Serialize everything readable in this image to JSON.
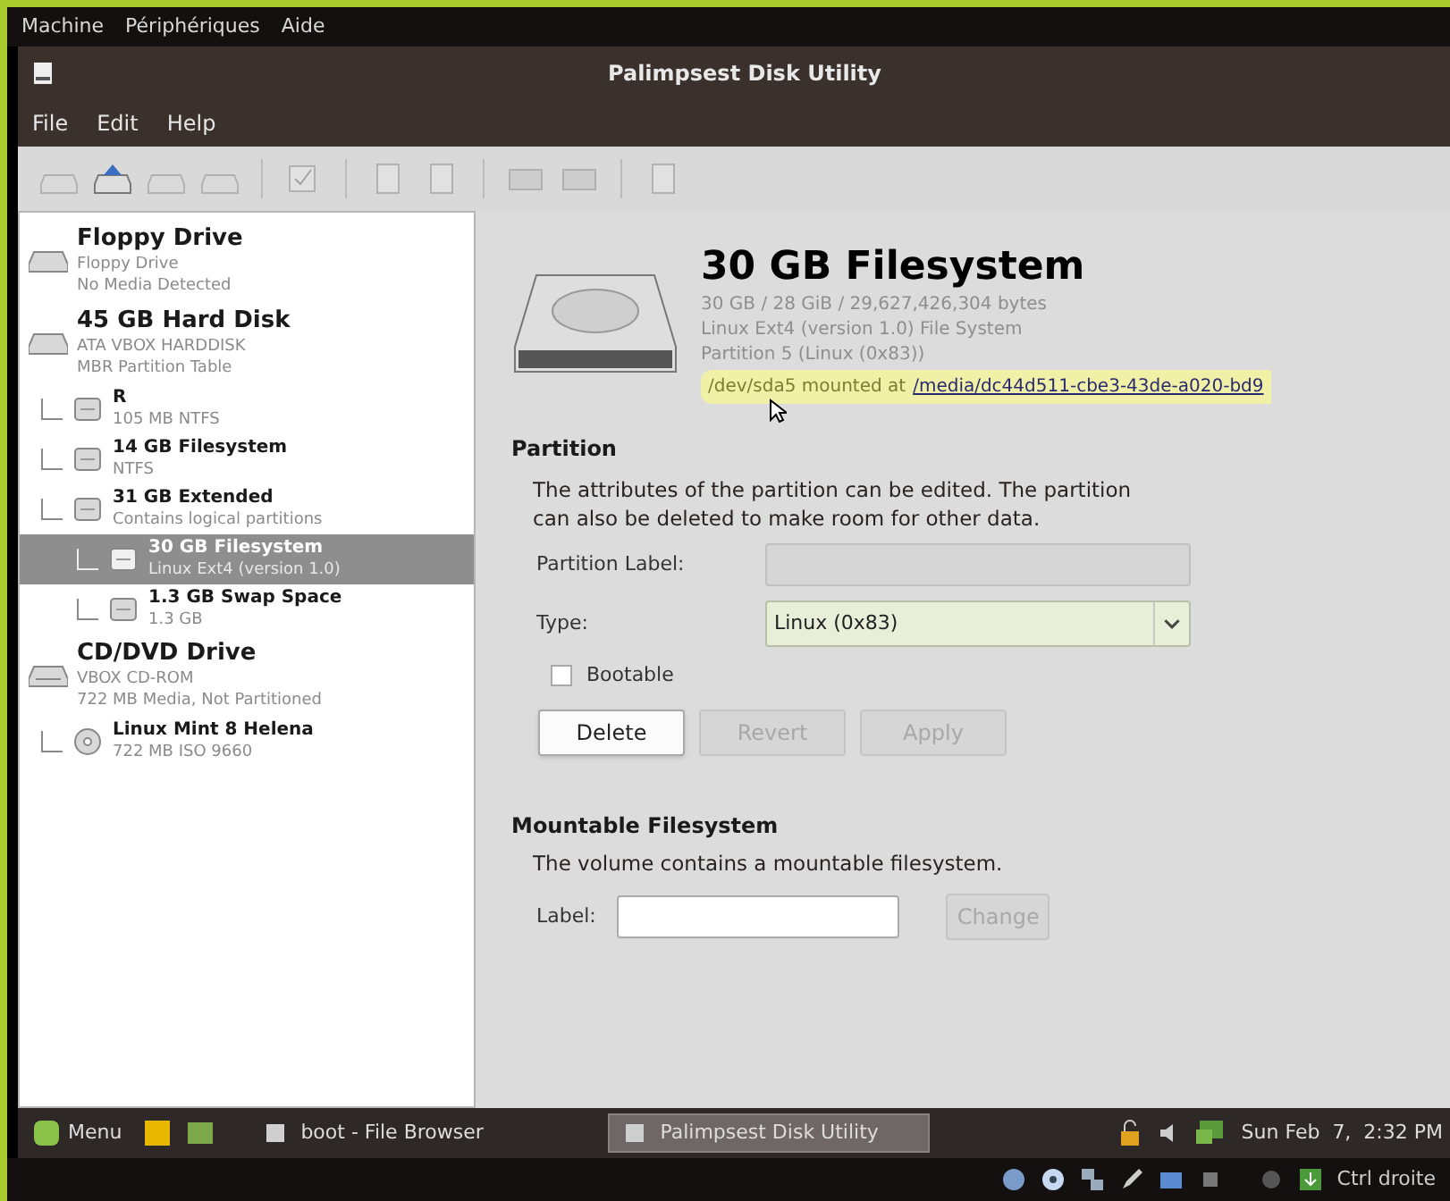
{
  "host_menu": [
    "Machine",
    "Périphériques",
    "Aide"
  ],
  "window": {
    "title": "Palimpsest Disk Utility"
  },
  "menu": [
    "File",
    "Edit",
    "Help"
  ],
  "toolbar": [
    {
      "kind": "drive",
      "disabled": true
    },
    {
      "kind": "drive-blue",
      "disabled": false
    },
    {
      "kind": "drive",
      "disabled": true
    },
    {
      "kind": "drive",
      "disabled": true
    },
    {
      "kind": "separator"
    },
    {
      "kind": "check",
      "disabled": true
    },
    {
      "kind": "separator"
    },
    {
      "kind": "doc",
      "disabled": true
    },
    {
      "kind": "doc",
      "disabled": true
    },
    {
      "kind": "separator"
    },
    {
      "kind": "screen",
      "disabled": true
    },
    {
      "kind": "screen",
      "disabled": true
    },
    {
      "kind": "separator"
    },
    {
      "kind": "doc",
      "disabled": true
    }
  ],
  "tree": [
    {
      "kind": "floppy",
      "title": "Floppy Drive",
      "lines": [
        "Floppy Drive",
        "No Media Detected"
      ],
      "selected": false
    },
    {
      "kind": "hdd",
      "title": "45 GB Hard Disk",
      "lines": [
        "ATA VBOX HARDDISK",
        "MBR Partition Table"
      ],
      "selected": false,
      "children": [
        {
          "kind": "partition",
          "title": "R",
          "lines": [
            "105 MB NTFS"
          ],
          "selected": false
        },
        {
          "kind": "partition",
          "title": "14 GB Filesystem",
          "lines": [
            "NTFS"
          ],
          "selected": false
        },
        {
          "kind": "partition",
          "title": "31 GB Extended",
          "lines": [
            "Contains logical partitions"
          ],
          "selected": false,
          "children": [
            {
              "kind": "partition",
              "title": "30 GB Filesystem",
              "lines": [
                "Linux Ext4 (version 1.0)"
              ],
              "selected": true
            },
            {
              "kind": "partition",
              "title": "1.3 GB Swap Space",
              "lines": [
                "1.3 GB"
              ],
              "selected": false
            }
          ]
        }
      ]
    },
    {
      "kind": "cdrom",
      "title": "CD/DVD Drive",
      "lines": [
        "VBOX CD-ROM",
        "722 MB Media, Not Partitioned"
      ],
      "selected": false,
      "children": [
        {
          "kind": "disc",
          "title": "Linux Mint 8 Helena",
          "lines": [
            "722 MB ISO 9660"
          ],
          "selected": false
        }
      ]
    }
  ],
  "details": {
    "title": "30 GB Filesystem",
    "lines": [
      "30 GB / 28 GiB / 29,627,426,304 bytes",
      "Linux Ext4 (version 1.0) File System",
      "Partition 5 (Linux (0x83))"
    ],
    "mount_text": "/dev/sda5 mounted at",
    "mount_link": "/media/dc44d511-cbe3-43de-a020-bd9"
  },
  "partition": {
    "heading": "Partition",
    "description": "The attributes of the partition can be edited. The partition can also be deleted to make room for other data.",
    "label_caption": "Partition Label:",
    "type_caption": "Type:",
    "type_value": "Linux (0x83)",
    "bootable": {
      "label": "Bootable",
      "checked": false
    },
    "buttons": [
      {
        "label": "Delete",
        "disabled": false
      },
      {
        "label": "Revert",
        "disabled": true
      },
      {
        "label": "Apply",
        "disabled": true
      }
    ]
  },
  "mountable": {
    "heading": "Mountable Filesystem",
    "description": "The volume contains a mountable filesystem.",
    "label_caption": "Label:",
    "button": {
      "label": "Change",
      "disabled": true
    }
  },
  "taskbar": {
    "menu": "Menu",
    "tasks": [
      {
        "label": "boot - File Browser",
        "selected": false
      },
      {
        "label": "Palimpsest Disk Utility",
        "selected": true
      }
    ],
    "clock": "Sun Feb  7,  2:32 PM"
  },
  "host_status": {
    "key": "Ctrl droite"
  }
}
